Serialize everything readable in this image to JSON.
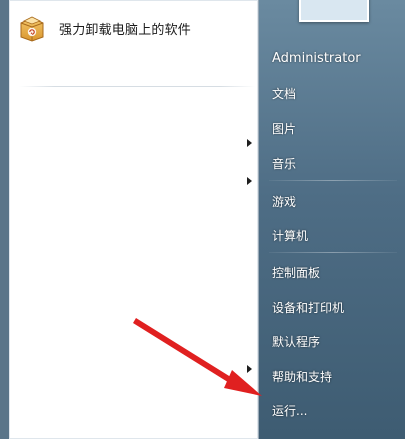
{
  "left_pane": {
    "programs": [
      {
        "label": "强力卸载电脑上的软件",
        "icon": "uninstaller-box-icon"
      }
    ],
    "submenu_arrow_count": 3
  },
  "right_pane": {
    "items": [
      {
        "name": "user-name",
        "label": "Administrator"
      },
      {
        "name": "documents",
        "label": "文档"
      },
      {
        "name": "pictures",
        "label": "图片"
      },
      {
        "name": "music",
        "label": "音乐"
      },
      {
        "name": "games",
        "label": "游戏"
      },
      {
        "name": "computer",
        "label": "计算机"
      },
      {
        "name": "control-panel",
        "label": "控制面板"
      },
      {
        "name": "devices-printers",
        "label": "设备和打印机"
      },
      {
        "name": "default-programs",
        "label": "默认程序"
      },
      {
        "name": "help-support",
        "label": "帮助和支持"
      },
      {
        "name": "run",
        "label": "运行..."
      }
    ]
  },
  "annotation": {
    "color": "#e02020",
    "target": "run"
  }
}
